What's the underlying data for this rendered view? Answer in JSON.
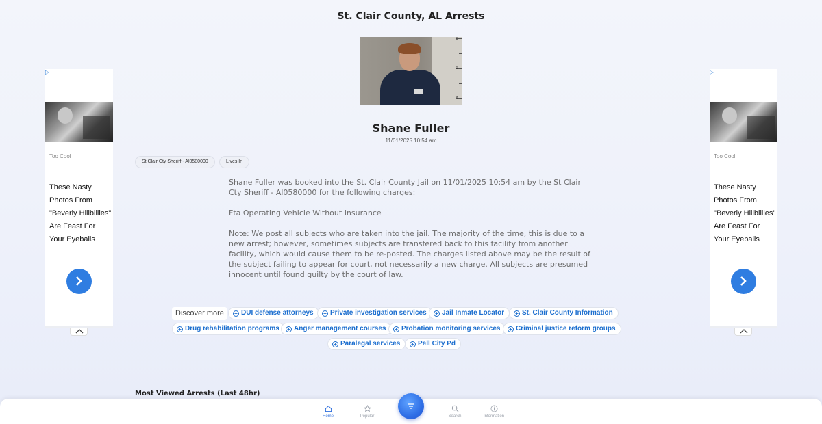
{
  "page_title": "St. Clair County, AL Arrests",
  "mugshot": {
    "ruler_numbers": [
      "6",
      "5",
      "4"
    ]
  },
  "person": {
    "name": "Shane Fuller",
    "booked_time": "11/01/2025 10:54 am"
  },
  "chips": [
    "St Clair Cty Sheriff - Al0580000",
    "Lives In"
  ],
  "description": {
    "booking": "Shane Fuller was booked into the St. Clair County Jail on 11/01/2025 10:54 am by the St Clair Cty Sheriff - Al0580000 for the following charges:",
    "charge": "Fta Operating Vehicle Without Insurance",
    "note": "Note: We post all subjects who are taken into the jail. The majority of the time, this is due to a new arrest; however, sometimes subjects are transfered back to this facility from another facility, which would cause them to be re-posted. The charges listed above may be the result of the subject failing to appear for court, not necessarily a new charge. All subjects are presumed innocent until found guilty by the court of law."
  },
  "ads": {
    "left": {
      "sponsor": "Too Cool",
      "headline": "These Nasty Photos From \"Beverly Hillbillies\" Are Feast For Your Eyeballs"
    },
    "right": {
      "sponsor": "Too Cool",
      "headline": "These Nasty Photos From \"Beverly Hillbillies\" Are Feast For Your Eyeballs"
    }
  },
  "discover": {
    "label": "Discover more",
    "pills": [
      "DUI defense attorneys",
      "Private investigation services",
      "Jail Inmate Locator",
      "St. Clair County Information",
      "Drug rehabilitation programs",
      "Anger management courses",
      "Probation monitoring services",
      "Criminal justice reform groups",
      "Paralegal services",
      "Pell City Pd"
    ]
  },
  "most_viewed_title": "Most Viewed Arrests (Last 48hr)",
  "nav": {
    "home": "Home",
    "popular": "Popular",
    "search": "Search",
    "information": "Information",
    "active": "home",
    "accent": "#2f6fdc"
  }
}
